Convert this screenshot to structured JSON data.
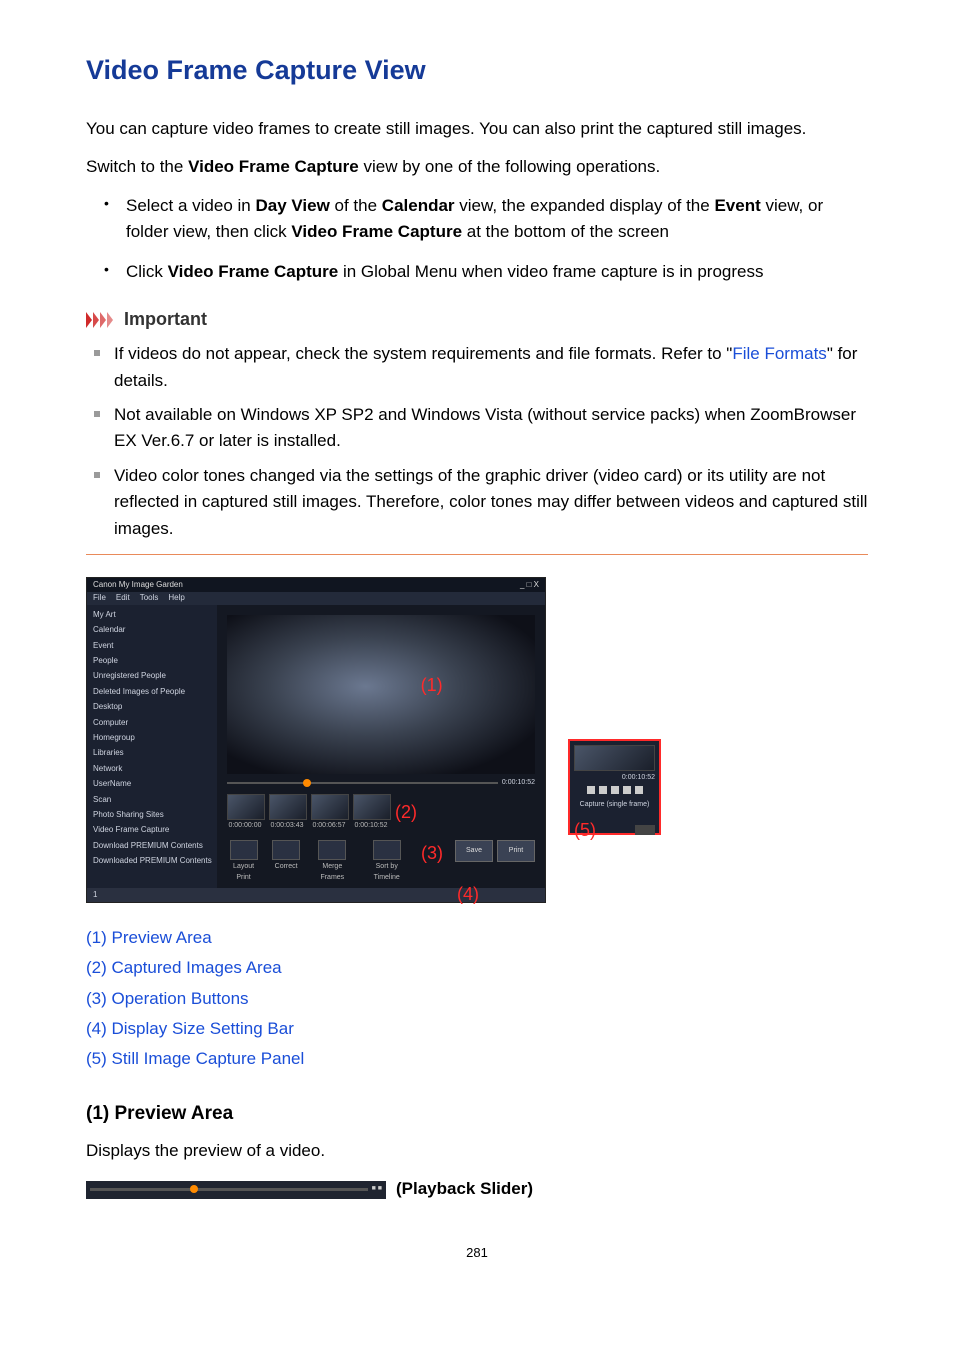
{
  "title": "Video Frame Capture View",
  "intro1": "You can capture video frames to create still images. You can also print the captured still images.",
  "intro2_pre": "Switch to the ",
  "intro2_bold": "Video Frame Capture",
  "intro2_post": " view by one of the following operations.",
  "bullets": {
    "b1_pre": "Select a video in ",
    "b1_b1": "Day View",
    "b1_mid1": " of the ",
    "b1_b2": "Calendar",
    "b1_mid2": " view, the expanded display of the ",
    "b1_b3": "Event",
    "b1_mid3": " view, or folder view, then click ",
    "b1_b4": "Video Frame Capture",
    "b1_post": " at the bottom of the screen",
    "b2_pre": "Click ",
    "b2_b1": "Video Frame Capture",
    "b2_post": " in Global Menu when video frame capture is in progress"
  },
  "important_label": "Important",
  "important": {
    "i1_pre": "If videos do not appear, check the system requirements and file formats. Refer to \"",
    "i1_link": "File Formats",
    "i1_post": "\" for details.",
    "i2": "Not available on Windows XP SP2 and Windows Vista (without service packs) when ZoomBrowser EX Ver.6.7 or later is installed.",
    "i3": "Video color tones changed via the settings of the graphic driver (video card) or its utility are not reflected in captured still images. Therefore, color tones may differ between videos and captured still images."
  },
  "screenshot": {
    "title": "Canon My Image Garden",
    "win_ctrls": "_ □ X",
    "menus": [
      "File",
      "Edit",
      "Tools",
      "Help"
    ],
    "side": [
      "My Art",
      "Calendar",
      "Event",
      "People",
      "Unregistered People",
      "Deleted Images of People",
      "Desktop",
      "Computer",
      "Homegroup",
      "Libraries",
      "Network",
      "UserName",
      "Scan",
      "Photo Sharing Sites",
      "Video Frame Capture",
      "Download PREMIUM Contents",
      "Downloaded PREMIUM Contents"
    ],
    "num1": "(1)",
    "duration": "0:00:10:52",
    "thumbs": [
      "0:00:00:00",
      "0:00:03:43",
      "0:00:06:57",
      "0:00:10:52"
    ],
    "num2": "(2)",
    "ops": [
      "Layout Print",
      "Correct",
      "Merge Frames",
      "Sort by Timeline"
    ],
    "num3": "(3)",
    "save": "Save",
    "print": "Print",
    "status_one": "1",
    "num4": "(4)",
    "panel_time": "0:00:10:52",
    "panel_cap": "Capture (single frame)",
    "num5": "(5)"
  },
  "toc": {
    "t1": "(1) Preview Area",
    "t2": "(2) Captured Images Area",
    "t3": "(3) Operation Buttons",
    "t4": "(4) Display Size Setting Bar",
    "t5": "(5) Still Image Capture Panel"
  },
  "section1_title": "(1) Preview Area",
  "section1_body": "Displays the preview of a video.",
  "playback_slider_label": " (Playback Slider)",
  "page_number": "281"
}
